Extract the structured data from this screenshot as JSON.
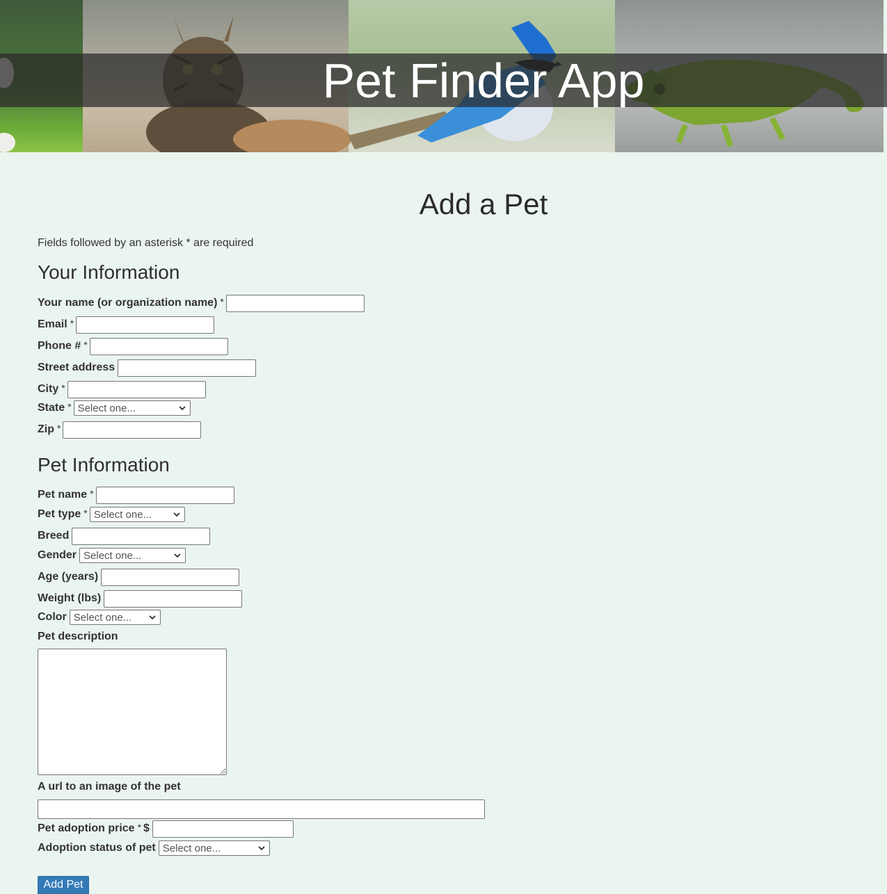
{
  "app": {
    "title": "Pet Finder App"
  },
  "page": {
    "title": "Add a Pet",
    "required_note": "Fields followed by an asterisk * are required"
  },
  "your_info": {
    "heading": "Your Information",
    "name_label": "Your name (or organization name)",
    "email_label": "Email",
    "phone_label": "Phone #",
    "street_label": "Street address",
    "city_label": "City",
    "state_label": "State",
    "state_value": "Select one...",
    "zip_label": "Zip"
  },
  "pet_info": {
    "heading": "Pet Information",
    "pet_name_label": "Pet name",
    "pet_type_label": "Pet type",
    "pet_type_value": "Select one...",
    "breed_label": "Breed",
    "gender_label": "Gender",
    "gender_value": "Select one...",
    "age_label": "Age (years)",
    "weight_label": "Weight (lbs)",
    "color_label": "Color",
    "color_value": "Select one...",
    "description_label": "Pet description",
    "image_url_label": "A url to an image of the pet",
    "price_label": "Pet adoption price",
    "price_prefix": "$",
    "status_label": "Adoption status of pet",
    "status_value": "Select one..."
  },
  "required_marker": "*",
  "submit_label": "Add Pet",
  "icons": {
    "select_arrow": "chevron-down-icon"
  }
}
